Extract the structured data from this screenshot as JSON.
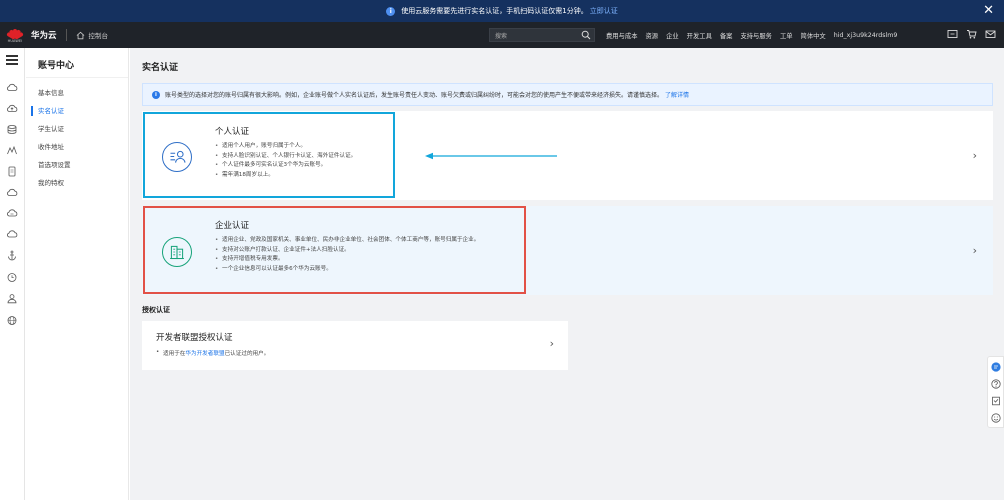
{
  "banner": {
    "text": "使用云服务需要先进行实名认证，手机扫码认证仅需1分钟。",
    "link": "立即认证",
    "info_icon": "i"
  },
  "header": {
    "brand": "华为云",
    "logo_text": "HUAWEI",
    "console": "控制台",
    "search_placeholder": "搜索",
    "nav": [
      "费用与成本",
      "资源",
      "企业",
      "开发工具",
      "备案",
      "支持与服务",
      "工单",
      "简体中文",
      "hid_xj3u9k24rdslm9"
    ],
    "icons": [
      "screen-icon",
      "cart-icon",
      "mail-icon"
    ]
  },
  "rail_icons": [
    "menu-icon",
    "cloud-icon",
    "cloud-upload-icon",
    "database-icon",
    "monitor-icon",
    "document-icon",
    "cloud-outline-icon",
    "cloud-network-icon",
    "cloud-sync-icon",
    "anchor-icon",
    "clock-icon",
    "user-group-icon",
    "globe-icon"
  ],
  "sidebar": {
    "title": "账号中心",
    "items": [
      {
        "label": "基本信息"
      },
      {
        "label": "实名认证"
      },
      {
        "label": "学生认证"
      },
      {
        "label": "收件地址"
      },
      {
        "label": "首选项设置"
      },
      {
        "label": "我的特权"
      }
    ],
    "active": "实名认证"
  },
  "main": {
    "title": "实名认证",
    "notice": {
      "text": "账号类型的选择对您的账号归属有很大影响。例如，企业账号做个人实名认证后，发生账号责任人变动、账号欠费或归属纠纷时，可能会对您的使用产生不便或带来经济损失。请谨慎选择。",
      "link": "了解详情"
    },
    "personal": {
      "title": "个人认证",
      "bullets": [
        "适用个人用户，账号归属于个人。",
        "支持人脸识别认证、个人银行卡认证、海外证件认证。",
        "个人证件最多可实名认证3个华为云账号。",
        "需年满18周岁以上。"
      ]
    },
    "enterprise": {
      "title": "企业认证",
      "bullets": [
        "适用企业、党政及国家机关、事业单位、民办非企业单位、社会团体、个体工商户等，账号归属于企业。",
        "支持对公账户打款认证、企业证件+法人扫脸认证。",
        "支持开增值税专用发票。",
        "一个企业信息可以认证最多6个华为云账号。"
      ]
    },
    "auth_section": {
      "label": "授权认证",
      "card_title": "开发者联盟授权认证",
      "desc_prefix": "适用于在",
      "desc_link": "华为开发者联盟",
      "desc_suffix": "已认证过的用户。"
    },
    "chevron": "›"
  },
  "float_tools": [
    "chat-icon",
    "help-icon",
    "feedback-icon",
    "smile-icon"
  ],
  "colors": {
    "banner_bg": "#15315f",
    "header_bg": "#1f2329",
    "accent": "#1a73e8",
    "personal_highlight": "#12a6db",
    "enterprise_highlight": "#e25146",
    "logo_red": "#e02228"
  }
}
